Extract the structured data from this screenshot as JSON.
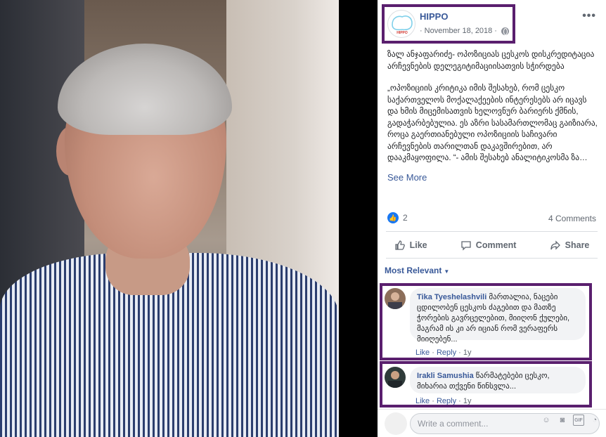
{
  "post": {
    "page_name": "HIPPO",
    "date": "November 18, 2018",
    "dot": "·",
    "text_p1": "ზალ ანჯაფარიძე- ოპოზიციას ცესკოს დისკრედიტაცია არჩევნების დელეგიტიმაციისათვის სჭირდება",
    "text_p2": "„ოპოზიციის კრიტიკა იმის შესახებ, რომ ცესკო საქართველოს მოქალაქეების ინტერესებს არ იცავს და ხმის მიცემისათვის ხელოვნურ ბარიერს ქმნის, გადაჭარბებულია. ეს აზრი სასამართლომაც გაიზიარა, როცა გაერთიანებული ოპოზიციის საჩივარი არჩევნების თარილთან დაკავშირებით, არ დააკმაყოფილა. “- ამის შესახებ ანალიტიკოსმა ზა…",
    "see_more": "See More",
    "like_count": "2",
    "comments_count": "4 Comments",
    "avatar_logo_text": "HIPPO"
  },
  "actions": {
    "like": "Like",
    "comment": "Comment",
    "share": "Share"
  },
  "relevance_label": "Most Relevant",
  "comments": [
    {
      "author": "Tika Tyeshelashvili",
      "text": "მართალია, ნაცები ცდილობენ ცესკოს ძაგებით და მათზე ჭორების გავრცელებით, მიიღონ ქულები, მაგრამ ის კი არ იციან რომ ვერაფერს მიიღებენ...",
      "like": "Like",
      "reply": "Reply",
      "age": "1y"
    },
    {
      "author": "Irakli Samushia",
      "text": "წარმატებები ცესკო, მიხარია თქვენი წინსვლა...",
      "like": "Like",
      "reply": "Reply",
      "age": "1y"
    }
  ],
  "composer": {
    "placeholder": "Write a comment..."
  },
  "colors": {
    "fb_blue": "#385898",
    "highlight": "#5a1f6e",
    "like_blue": "#1877f2"
  }
}
